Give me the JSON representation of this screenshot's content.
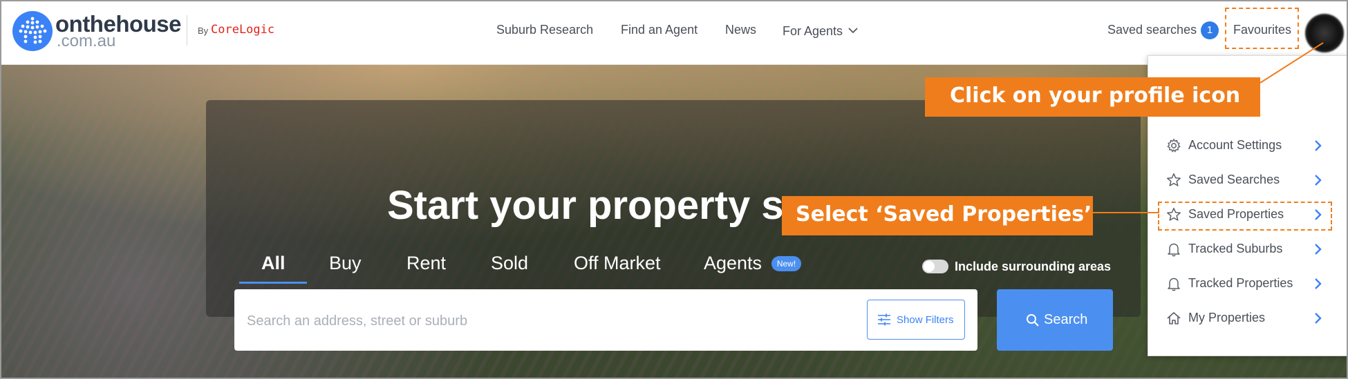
{
  "header": {
    "logo_name": "onthehouse",
    "logo_domain": ".com.au",
    "by_text": "By",
    "partner": "CoreLogic",
    "nav": [
      {
        "label": "Suburb Research"
      },
      {
        "label": "Find an Agent"
      },
      {
        "label": "News"
      },
      {
        "label": "For Agents"
      }
    ],
    "saved_searches_label": "Saved searches",
    "saved_searches_count": "1",
    "favourites_label": "Favourites"
  },
  "hero": {
    "headline": "Start your property se",
    "tabs": [
      {
        "label": "All",
        "active": true
      },
      {
        "label": "Buy"
      },
      {
        "label": "Rent"
      },
      {
        "label": "Sold"
      },
      {
        "label": "Off Market"
      },
      {
        "label": "Agents"
      }
    ],
    "new_badge": "New!",
    "toggle_label": "Include surrounding areas",
    "search_placeholder": "Search an address, street or suburb",
    "show_filters_label": "Show Filters",
    "search_button_label": "Search"
  },
  "profile_menu": {
    "items": [
      {
        "label": "Account Settings",
        "icon": "gear-icon"
      },
      {
        "label": "Saved Searches",
        "icon": "star-icon"
      },
      {
        "label": "Saved Properties",
        "icon": "star-icon"
      },
      {
        "label": "Tracked Suburbs",
        "icon": "bell-icon"
      },
      {
        "label": "Tracked Properties",
        "icon": "bell-icon"
      },
      {
        "label": "My Properties",
        "icon": "home-icon"
      }
    ]
  },
  "annotations": {
    "callout_profile": "Click on your profile icon",
    "callout_saved_properties": "Select ‘Saved Properties’"
  },
  "colors": {
    "brand_blue": "#3b82f6",
    "annotation_orange": "#f07d1b",
    "corelogic_red": "#e2231a"
  }
}
